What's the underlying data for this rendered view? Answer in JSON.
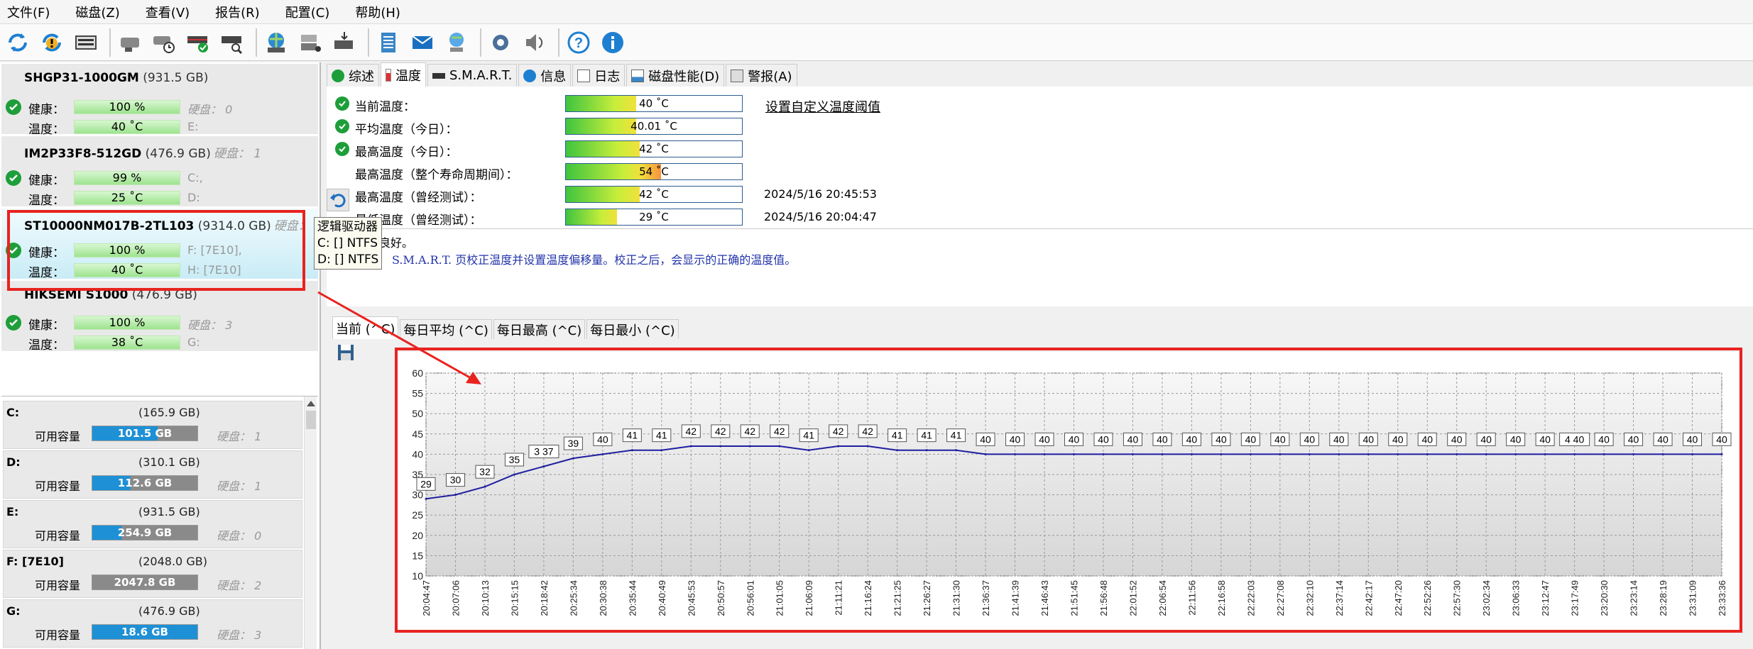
{
  "menu": [
    "文件(F)",
    "磁盘(Z)",
    "查看(V)",
    "报告(R)",
    "配置(C)",
    "帮助(H)"
  ],
  "toolbar_icons": [
    "refresh-icon",
    "refresh-warning-icon",
    "disk-info-icon",
    "disk-icon",
    "disk-timer-icon",
    "disk-check-icon",
    "disk-search-icon",
    "globe-disk-icon",
    "network-drive-icon",
    "disk-export-icon",
    "notes-icon",
    "mail-icon",
    "remote-computer-icon",
    "gear-icon",
    "speaker-icon",
    "help-icon",
    "info-icon"
  ],
  "disks": [
    {
      "name": "SHGP31-1000GM",
      "size": "(931.5 GB)",
      "extra": "",
      "health_label": "健康：",
      "health": "100 %",
      "temp_label": "温度：",
      "temp": "40 ˚C",
      "side1": "硬盘： 0",
      "side2": "E:"
    },
    {
      "name": "IM2P33F8-512GD",
      "size": "(476.9 GB)",
      "extra": "硬盘： 1",
      "health_label": "健康：",
      "health": "99 %",
      "temp_label": "温度：",
      "temp": "25 ˚C",
      "side1": "C:,",
      "side2": "D:"
    },
    {
      "name": "ST10000NM017B-2TL103",
      "size": "(9314.0 GB)",
      "extra": "硬盘： 2",
      "health_label": "健康：",
      "health": "100 %",
      "temp_label": "温度：",
      "temp": "40 ˚C",
      "side1": "F: [7E10],",
      "side2": "H: [7E10]"
    },
    {
      "name": "HIKSEMI S1000",
      "size": "(476.9 GB)",
      "extra": "",
      "health_label": "健康：",
      "health": "100 %",
      "temp_label": "温度：",
      "temp": "38 ˚C",
      "side1": "硬盘： 3",
      "side2": "G:"
    }
  ],
  "volumes": [
    {
      "name": "C:",
      "size": "(165.9 GB)",
      "label": "可用容量",
      "free": "101.5 GB",
      "disk": "硬盘： 1",
      "color": "#1e90d6"
    },
    {
      "name": "D:",
      "size": "(310.1 GB)",
      "label": "可用容量",
      "free": "112.6 GB",
      "disk": "硬盘： 1",
      "color": "#1e90d6"
    },
    {
      "name": "E:",
      "size": "(931.5 GB)",
      "label": "可用容量",
      "free": "254.9 GB",
      "disk": "硬盘： 0",
      "color": "#1e90d6"
    },
    {
      "name": "F: [7E10]",
      "size": "(2048.0 GB)",
      "label": "可用容量",
      "free": "2047.8 GB",
      "disk": "硬盘： 2",
      "color": "#8a8a8a"
    },
    {
      "name": "G:",
      "size": "(476.9 GB)",
      "label": "可用容量",
      "free": "18.6 GB",
      "disk": "硬盘： 3",
      "color": "#1e90d6"
    }
  ],
  "tooltip": {
    "title": "逻辑驱动器",
    "line1": "C: [] NTFS",
    "line2": "D: [] NTFS"
  },
  "tabs": [
    "综述",
    "温度",
    "S.M.A.R.T.",
    "信息",
    "日志",
    "磁盘性能(D)",
    "警报(A)"
  ],
  "temperature": [
    {
      "label": "当前温度：",
      "value": "40 ˚C",
      "fraction": 0.4,
      "time": "",
      "check": true
    },
    {
      "label": "平均温度（今日）：",
      "value": "40.01 ˚C",
      "fraction": 0.4,
      "time": "",
      "check": true
    },
    {
      "label": "最高温度（今日）：",
      "value": "42 ˚C",
      "fraction": 0.42,
      "time": "",
      "check": true
    },
    {
      "label": "最高温度（整个寿命周期间）：",
      "value": "54 ˚C",
      "fraction": 0.54,
      "time": "",
      "check": false
    },
    {
      "label": "最高温度（曾经测试）：",
      "value": "42 ˚C",
      "fraction": 0.42,
      "time": "2024/5/16 20:45:53",
      "check": false
    },
    {
      "label": "最低温度（曾经测试）：",
      "value": "29 ˚C",
      "fraction": 0.29,
      "time": "2024/5/16 20:04:47",
      "check": false
    }
  ],
  "temp_link": "设置自定义温度阈值",
  "info": {
    "line1": "良好。",
    "line2": "S.M.A.R.T. 页校正温度并设置温度偏移量。校正之后，会显示的正确的温度值。"
  },
  "chart_tabs": [
    "当前 (^C)",
    "每日平均 (^C)",
    "每日最高 (^C)",
    "每日最小 (^C)"
  ],
  "chart_data": {
    "type": "line",
    "ylim": [
      10,
      60
    ],
    "yticks": [
      10,
      15,
      20,
      25,
      30,
      35,
      40,
      45,
      50,
      55,
      60
    ],
    "grid": true,
    "x": [
      "20:04:47",
      "20:07:06",
      "20:10:13",
      "20:15:15",
      "20:18:42",
      "20:25:34",
      "20:30:38",
      "20:35:44",
      "20:40:49",
      "20:45:53",
      "20:50:57",
      "20:56:01",
      "21:01:05",
      "21:06:09",
      "21:11:21",
      "21:16:24",
      "21:21:25",
      "21:26:27",
      "21:31:30",
      "21:36:37",
      "21:41:39",
      "21:46:43",
      "21:51:45",
      "21:56:48",
      "22:01:52",
      "22:06:54",
      "22:11:56",
      "22:16:58",
      "22:22:03",
      "22:27:08",
      "22:32:10",
      "22:37:14",
      "22:42:17",
      "22:47:20",
      "22:52:26",
      "22:57:30",
      "23:02:34",
      "23:06:33",
      "23:12:47",
      "23:17:49",
      "23:20:30",
      "23:23:14",
      "23:28:19",
      "23:31:09",
      "23:33:36"
    ],
    "series": [
      {
        "values": [
          29,
          30,
          32,
          35,
          37,
          39,
          40,
          41,
          41,
          42,
          42,
          42,
          42,
          41,
          42,
          42,
          41,
          41,
          41,
          40,
          40,
          40,
          40,
          40,
          40,
          40,
          40,
          40,
          40,
          40,
          40,
          40,
          40,
          40,
          40,
          40,
          40,
          40,
          40,
          40,
          40,
          40,
          40,
          40,
          40
        ]
      }
    ],
    "labels": [
      "29",
      "30",
      "32",
      "35",
      "3 37",
      "39",
      "40",
      "41",
      "41",
      "42",
      "42",
      "42",
      "42",
      "41",
      "42",
      "42",
      "41",
      "41",
      "41",
      "40",
      "40",
      "40",
      "40",
      "40",
      "40",
      "40",
      "40",
      "40",
      "40",
      "40",
      "40",
      "40",
      "40",
      "40",
      "40",
      "40",
      "40",
      "40",
      "40",
      "4 40",
      "40",
      "40",
      "40",
      "40",
      "40"
    ]
  },
  "colors": {
    "accent": "#e8231f",
    "line": "#1f1fa0",
    "check": "#1e9e3a"
  }
}
